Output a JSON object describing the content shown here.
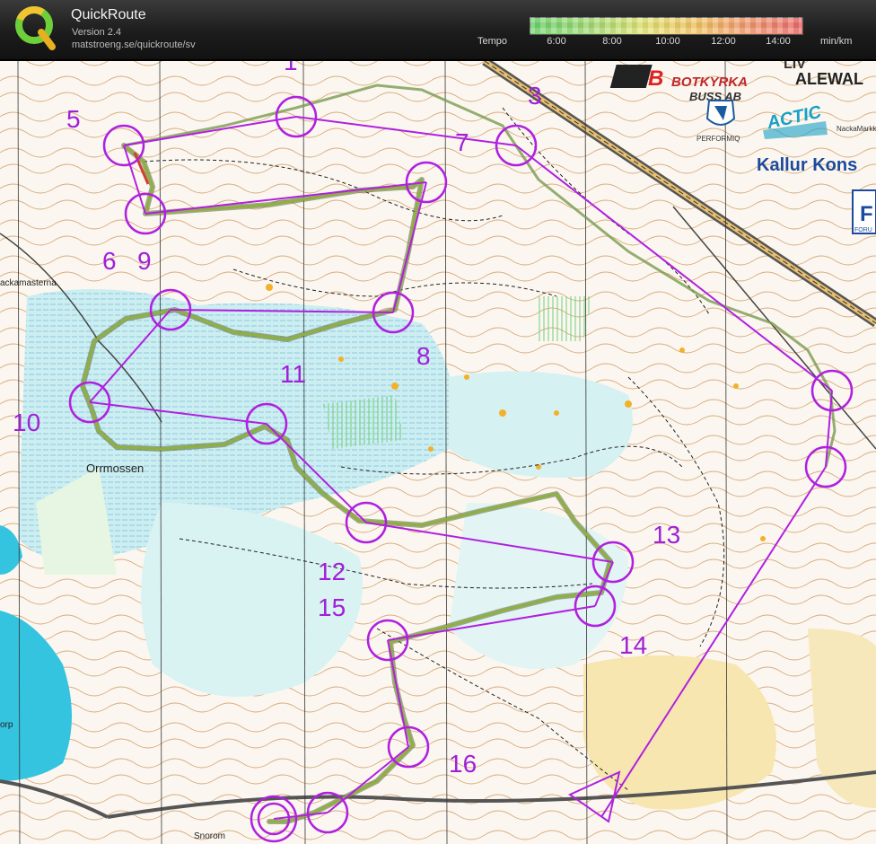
{
  "app": {
    "title": "QuickRoute",
    "version": "Version 2.4",
    "url": "matstroeng.se/quickroute/sv"
  },
  "legend": {
    "label": "Tempo",
    "ticks": [
      "6:00",
      "8:00",
      "10:00",
      "12:00",
      "14:00"
    ],
    "unit": "min/km",
    "colors": [
      "#6fd66f",
      "#e6e676",
      "#ee6f6f"
    ]
  },
  "map": {
    "sponsors": {
      "bus_name_1": "BOTKYRKA",
      "bus_name_2": "BUSS AB",
      "alewal": "ALEWAL",
      "liv": "LIV",
      "performiq": "PERFORMIQ",
      "actic": "ACTIC",
      "nacka": "NackaMarkk",
      "kallur": "Kallur Kons",
      "foru": "FORU"
    },
    "place_names": [
      "Orrmossen",
      "ackamasterna",
      "Snorom",
      "orp"
    ],
    "control_numbers": [
      "1",
      "3",
      "5",
      "7",
      "6",
      "9",
      "8",
      "11",
      "10",
      "12",
      "15",
      "13",
      "14",
      "16"
    ],
    "colors": {
      "course": "#b020e0",
      "route": "#7a9a50"
    }
  }
}
